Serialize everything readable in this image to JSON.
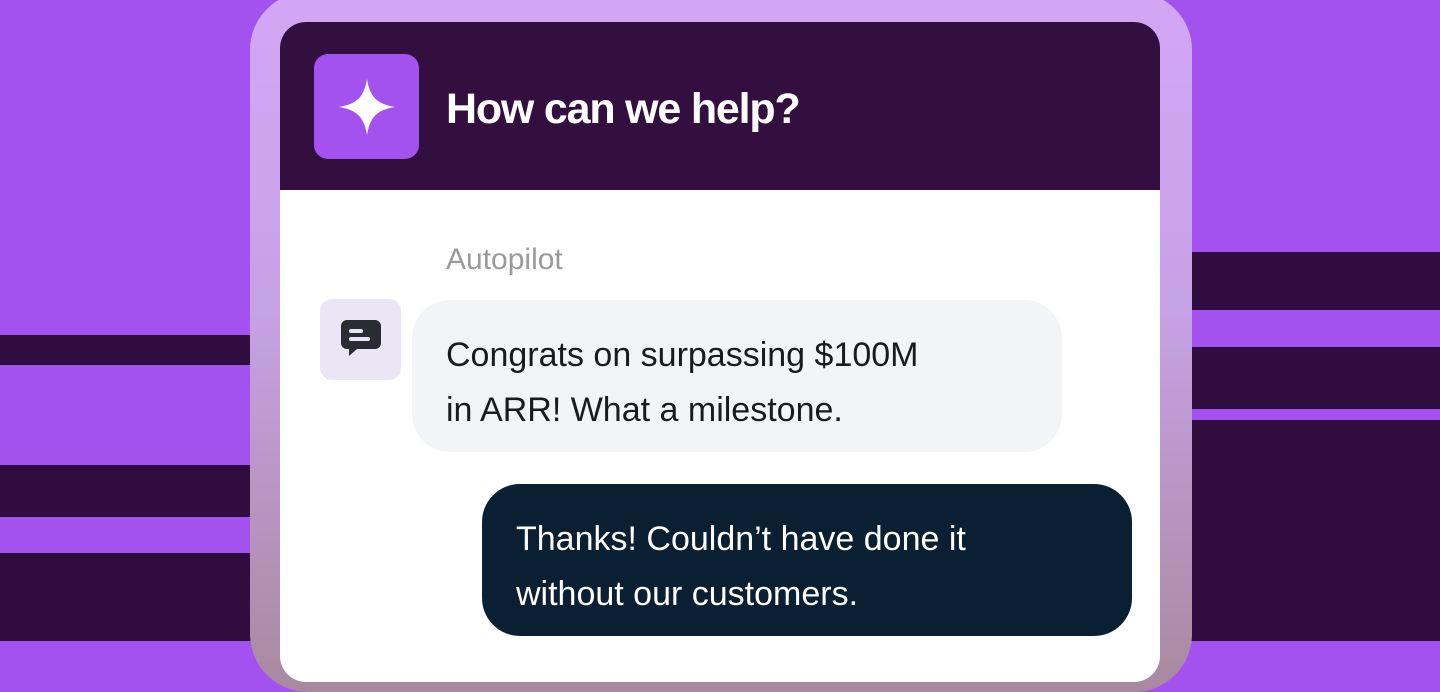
{
  "header": {
    "title": "How can we help?",
    "icon": "sparkle-icon"
  },
  "conversation": {
    "sender_label": "Autopilot",
    "bot_avatar_icon": "chat-bubble-icon",
    "messages": [
      {
        "from": "bot",
        "lines": [
          "Congrats on surpassing $100M",
          "in ARR! What a milestone."
        ]
      },
      {
        "from": "user",
        "lines": [
          "Thanks! Couldn’t have done it",
          "without our customers."
        ]
      }
    ]
  },
  "colors": {
    "background": "#a452ef",
    "stripes": "#2f0e3f",
    "header_bg": "#330f40",
    "accent": "#a452ef",
    "bot_bubble": "#f3f4f6",
    "user_bubble": "#0b1f33"
  }
}
